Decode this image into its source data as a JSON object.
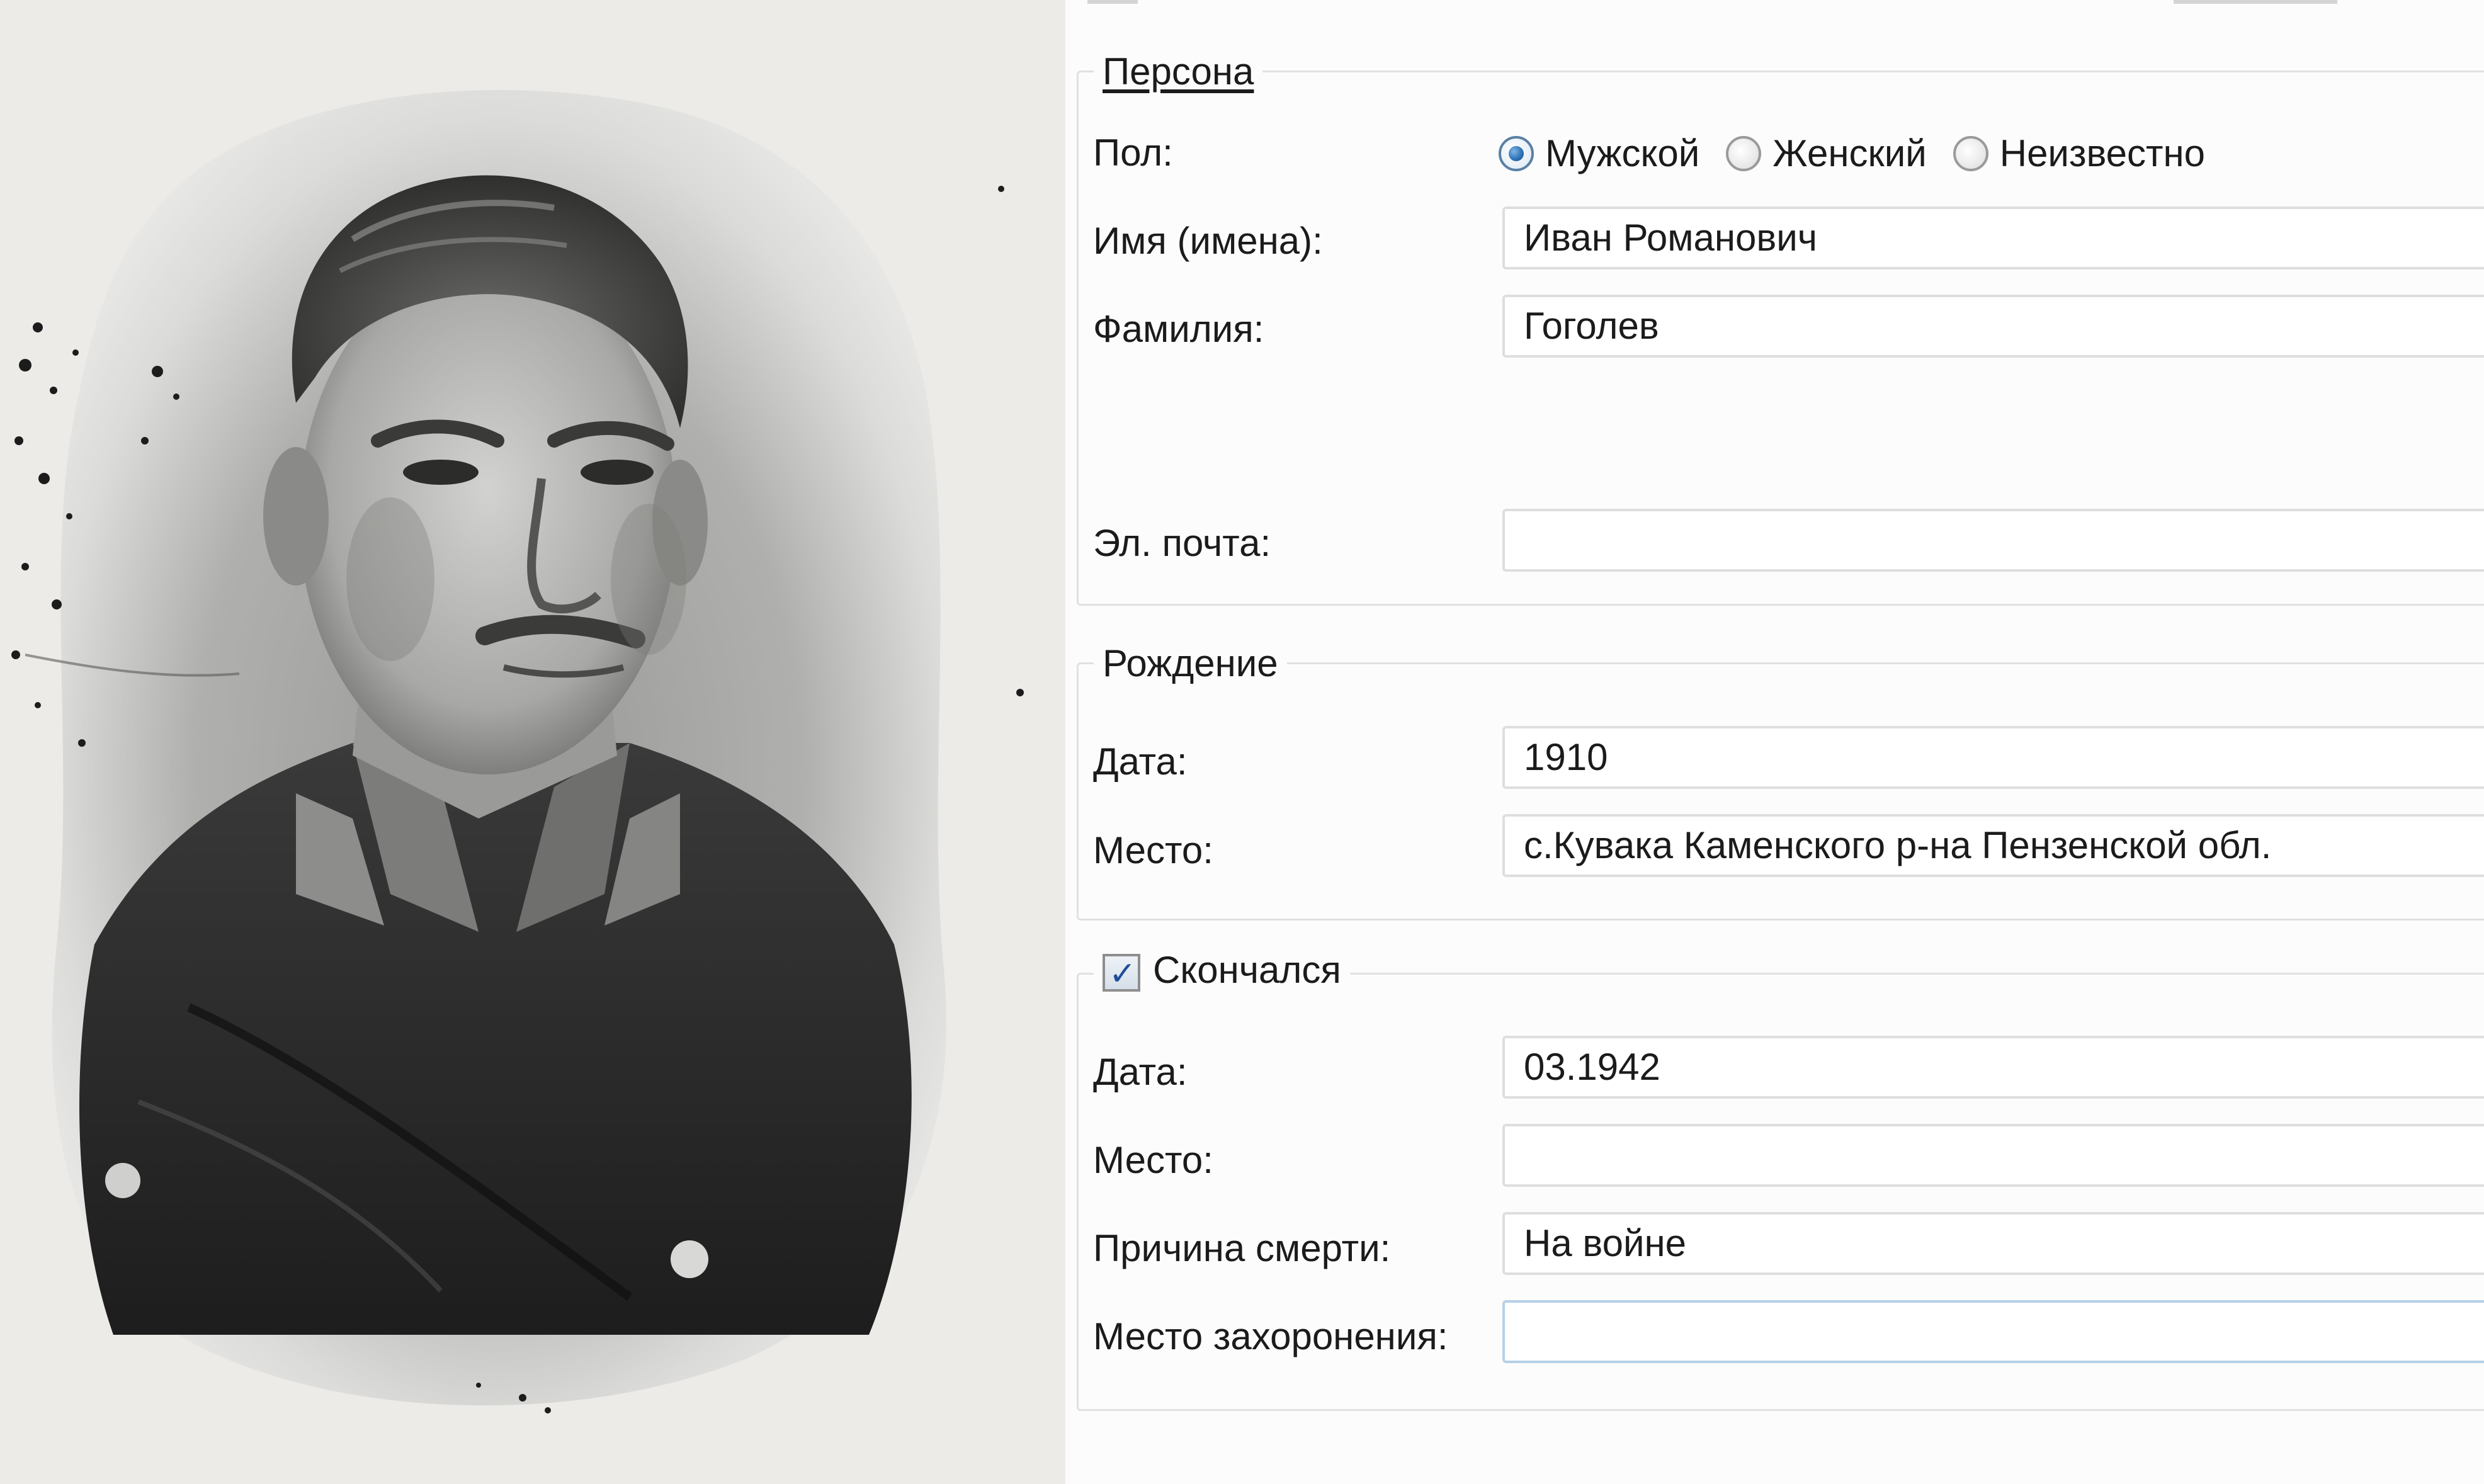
{
  "person_section": {
    "legend": "Персона",
    "gender_label": "Пол:",
    "gender_options": [
      {
        "label": "Мужской",
        "checked": true
      },
      {
        "label": "Женский",
        "checked": false
      },
      {
        "label": "Неизвестно",
        "checked": false
      }
    ],
    "first_name_label": "Имя (имена):",
    "first_name_value": "Иван Романович",
    "last_name_label": "Фамилия:",
    "last_name_value": "Гоголев",
    "email_label": "Эл. почта:",
    "email_value": ""
  },
  "birth_section": {
    "legend": "Рождение",
    "date_label": "Дата:",
    "date_value": "1910",
    "place_label": "Место:",
    "place_value": "с.Кувака Каменского р-на Пензенской обл."
  },
  "death_section": {
    "legend": "Скончался",
    "deceased_checked": true,
    "date_label": "Дата:",
    "date_value": "03.1942",
    "place_label": "Место:",
    "place_value": "",
    "cause_label": "Причина смерти:",
    "cause_value": "На войне",
    "burial_label": "Место захоронения:",
    "burial_value": ""
  },
  "colors": {
    "radio_selected": "#2a6fb5",
    "checkbox_mark": "#1f4f9a",
    "field_border": "#dedede",
    "group_border": "#e1e1e1"
  }
}
